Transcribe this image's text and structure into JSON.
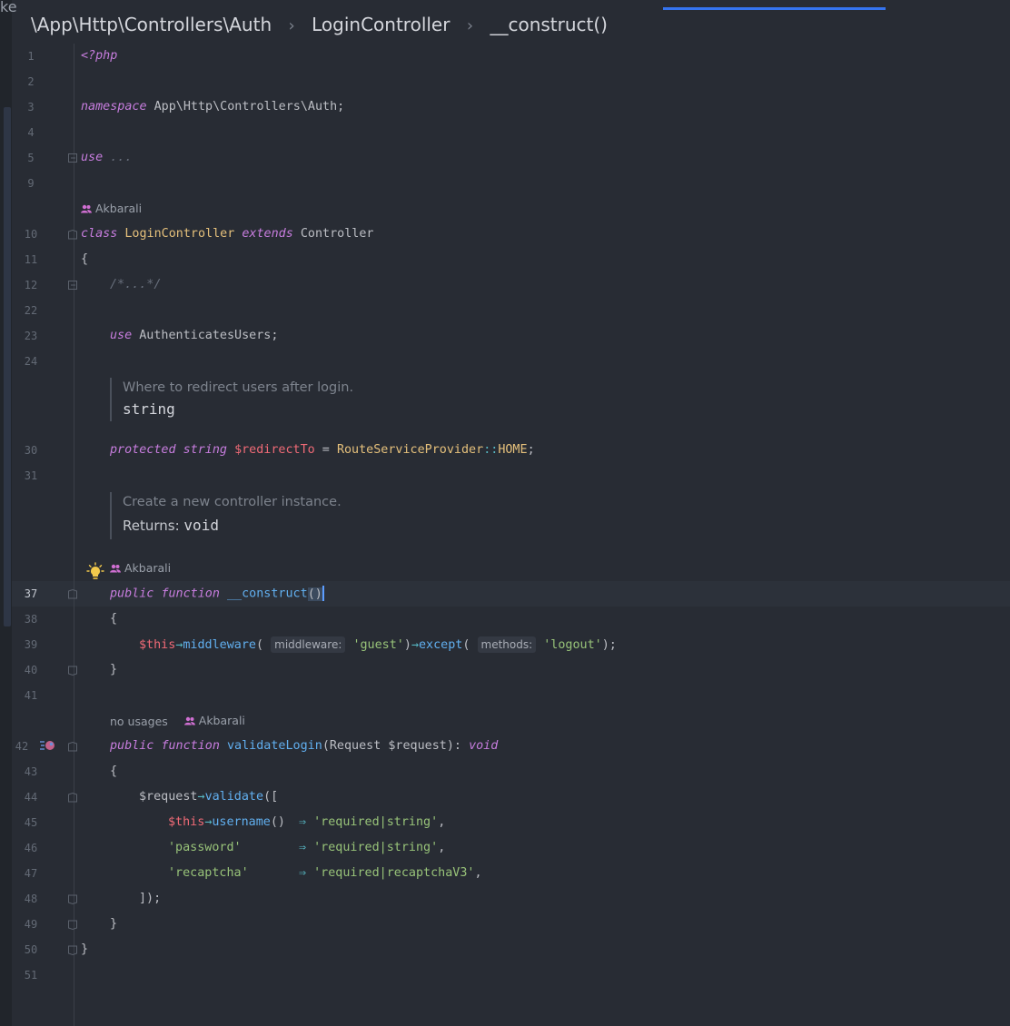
{
  "window": {
    "clipped_left_char": "ke"
  },
  "breadcrumb": {
    "namespace": "\\App\\Http\\Controllers\\Auth",
    "sep": "›",
    "class": "LoginController",
    "method": "__construct()"
  },
  "line_numbers": [
    "1",
    "2",
    "3",
    "4",
    "5",
    "9",
    "10",
    "11",
    "12",
    "22",
    "23",
    "24",
    "30",
    "31",
    "37",
    "38",
    "39",
    "40",
    "41",
    "42",
    "43",
    "44",
    "45",
    "46",
    "47",
    "48",
    "49",
    "50",
    "51"
  ],
  "code": {
    "php_open": "<?php",
    "ns_kw": "namespace",
    "ns_path": " App\\Http\\Controllers\\Auth;",
    "use_kw": "use",
    "use_folded": " ...",
    "class_kw": "class",
    "class_name": "LoginController",
    "extends_kw": "extends",
    "parent": "Controller",
    "open_brace": "{",
    "close_brace": "}",
    "folded_comment": "/*...*/",
    "trait_use_kw": "use",
    "trait_name": " AuthenticatesUsers;",
    "protected_kw": "protected",
    "string_kw": "string",
    "redirect_var": "$redirectTo",
    "assign": " = ",
    "rsp": "RouteServiceProvider",
    "scope_op": "::",
    "home_const": "HOME",
    "semi": ";",
    "public_kw": "public",
    "function_kw": "function",
    "construct_name": "__construct",
    "construct_parens": "()",
    "this_var": "$this",
    "arrow": "→",
    "middleware_fn": "middleware",
    "hint_middleware": "middleware:",
    "guest_str": "'guest'",
    "except_fn": "except",
    "hint_methods": "methods:",
    "logout_str": "'logout'",
    "call_end": ");",
    "validate_login_name": "validateLogin",
    "validate_params_a": "(Request ",
    "request_param": "$request",
    "validate_params_b": "): ",
    "void_kw": "void",
    "request_var": "$request",
    "validate_fn": "validate",
    "validate_open": "([",
    "username_fn": "username",
    "empty_call": "() ",
    "fat_arrow": "⇒",
    "req_string": "'required|string'",
    "comma": ",",
    "password_key": "'password'",
    "recaptcha_key": "'recaptcha'",
    "req_recaptcha": "'required|recaptchaV3'",
    "array_close": "]);"
  },
  "lens": {
    "author": "Akbarali",
    "no_usages": "no usages"
  },
  "docs": {
    "redirect_text": "Where to redirect users after login.",
    "redirect_type": "string",
    "construct_text": "Create a new controller instance.",
    "returns_label": "Returns: ",
    "returns_type": "void"
  },
  "colors": {
    "background": "#282c34",
    "keyword": "#c77dde",
    "class": "#e5c07b",
    "variable": "#ef6a76",
    "function": "#61afef",
    "string": "#98c379",
    "operator": "#56b6c2",
    "accent": "#3574f0"
  },
  "icons": {
    "author": "people-icon",
    "intention": "lightbulb-icon",
    "run": "run-gutter-icon",
    "fold": "fold-marker-icon"
  }
}
